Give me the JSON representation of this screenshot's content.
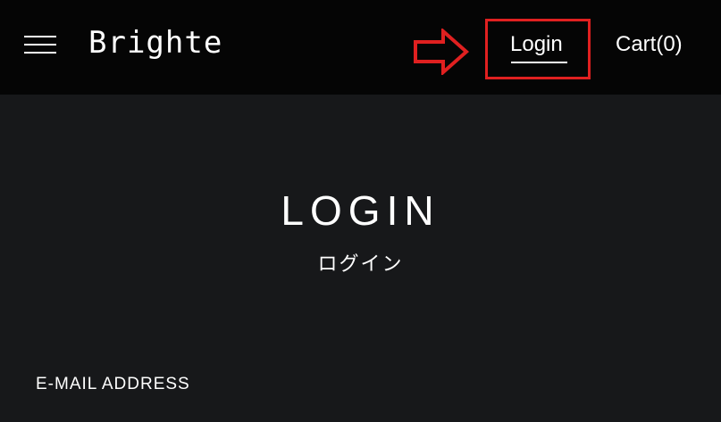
{
  "header": {
    "logo": "Brighte",
    "nav": {
      "login_label": "Login",
      "cart_label": "Cart(0)"
    }
  },
  "main": {
    "title": "LOGIN",
    "subtitle": "ログイン",
    "email_label": "E-MAIL ADDRESS"
  },
  "colors": {
    "header_bg": "#050505",
    "page_bg": "#17181a",
    "highlight": "#e02020",
    "text": "#ffffff"
  },
  "icons": {
    "menu": "hamburger-menu-icon",
    "annotation_arrow": "right-arrow-icon"
  }
}
